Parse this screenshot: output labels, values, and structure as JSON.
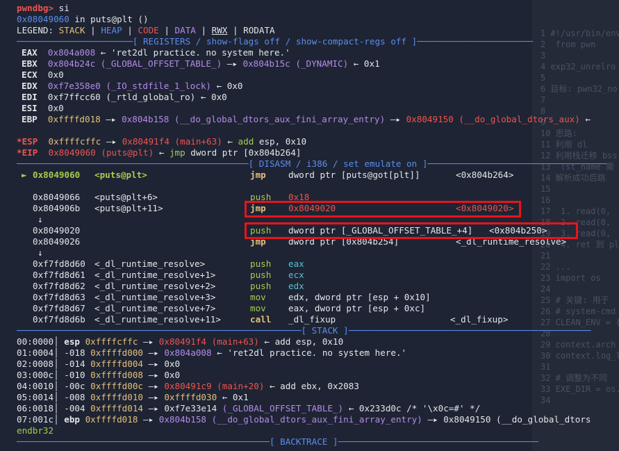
{
  "prompt": {
    "name": "pwndbg>",
    "cmd": " si"
  },
  "addr_line": {
    "addr": "0x08049060",
    "rest": " in puts@plt ()"
  },
  "legend": {
    "prefix": "LEGEND: ",
    "stack": "STACK",
    "heap": "HEAP",
    "code": "CODE",
    "data": "DATA",
    "rwx": "RWX",
    "rodata": "RODATA",
    "sep": " | "
  },
  "headers": {
    "registers": "[ REGISTERS / show-flags off / show-compact-regs off ]",
    "disasm": "[ DISASM / i386 / set emulate on ]",
    "stack": "[ STACK ]",
    "backtrace": "[ BACKTRACE ]"
  },
  "registers": {
    "eax": {
      "name": "EAX",
      "val": "0x804a008",
      "arrow": " ← ",
      "str": "'ret2dl practice. no system here.'"
    },
    "ebx": {
      "name": "EBX",
      "val": "0x804b24c",
      "sym": "(_GLOBAL_OFFSET_TABLE_)",
      "arrow": " —▸ ",
      "val2": "0x804b15c",
      "sym2": "(_DYNAMIC)",
      "arrow2": " ← ",
      "val3": "0x1"
    },
    "ecx": {
      "name": "ECX",
      "val": "0x0"
    },
    "edx": {
      "name": "EDX",
      "val": "0xf7e358e0",
      "sym": "(_IO_stdfile_1_lock)",
      "arrow": " ← ",
      "val2": "0x0"
    },
    "edi": {
      "name": "EDI",
      "val": "0xf7ffcc60",
      "sym": "(_rtld_global_ro)",
      "arrow": " ← ",
      "val2": "0x0"
    },
    "esi": {
      "name": "ESI",
      "val": "0x0"
    },
    "ebp": {
      "name": "EBP",
      "val": "0xffffd018",
      "arrow": " —▸ ",
      "val2": "0x804b158",
      "sym2": "(__do_global_dtors_aux_fini_array_entry)",
      "arrow2": " —▸ ",
      "val3": "0x8049150",
      "sym3": "(__do_global_dtors_aux)",
      "arrow3": " ←"
    },
    "esp": {
      "name": "*ESP",
      "val": "0xffffcffc",
      "arrow": " —▸ ",
      "val2": "0x80491f4",
      "sym2": "(main+63)",
      "arrow2": " ← ",
      "ins": "add",
      "ops": " esp, 0x10"
    },
    "eip": {
      "name": "*EIP",
      "val": "0x8049060",
      "sym": "(puts@plt)",
      "arrow": " ← ",
      "ins": "jmp",
      "ops": " dword ptr [0x804b264]"
    }
  },
  "disasm": [
    {
      "marker": "► ",
      "addr": "0x8049060",
      "sym": "<puts@plt>",
      "mn": "jmp",
      "ops": "dword ptr [puts@got[plt]]",
      "cmt": "<0x804b264>"
    },
    {
      "marker": "",
      "addr": "0x8049066",
      "sym": "<puts@plt+6>",
      "mn": "push",
      "ops": "0x18",
      "cmt": ""
    },
    {
      "marker": "",
      "addr": "0x804906b",
      "sym": "<puts@plt+11>",
      "mn": "jmp",
      "ops": "0x8049020",
      "cmt": "<0x8049020>"
    },
    {
      "marker": "↓",
      "addr": "",
      "sym": "",
      "mn": "",
      "ops": "",
      "cmt": ""
    },
    {
      "marker": "",
      "addr": "0x8049020",
      "sym": "",
      "mn": "push",
      "ops": "dword ptr [_GLOBAL_OFFSET_TABLE_+4]",
      "cmt": "<0x804b250>"
    },
    {
      "marker": "",
      "addr": "0x8049026",
      "sym": "",
      "mn": "jmp",
      "ops": "dword ptr [0x804b254]",
      "cmt": "<_dl_runtime_resolve>"
    },
    {
      "marker": "↓",
      "addr": "",
      "sym": "",
      "mn": "",
      "ops": "",
      "cmt": ""
    },
    {
      "marker": "",
      "addr": "0xf7fd8d60",
      "sym": "<_dl_runtime_resolve>",
      "mn": "push",
      "ops": "eax",
      "cmt": ""
    },
    {
      "marker": "",
      "addr": "0xf7fd8d61",
      "sym": "<_dl_runtime_resolve+1>",
      "mn": "push",
      "ops": "ecx",
      "cmt": ""
    },
    {
      "marker": "",
      "addr": "0xf7fd8d62",
      "sym": "<_dl_runtime_resolve+2>",
      "mn": "push",
      "ops": "edx",
      "cmt": ""
    },
    {
      "marker": "",
      "addr": "0xf7fd8d63",
      "sym": "<_dl_runtime_resolve+3>",
      "mn": "mov",
      "ops": "edx, dword ptr [esp + 0x10]",
      "cmt": ""
    },
    {
      "marker": "",
      "addr": "0xf7fd8d67",
      "sym": "<_dl_runtime_resolve+7>",
      "mn": "mov",
      "ops": "eax, dword ptr [esp + 0xc]",
      "cmt": ""
    },
    {
      "marker": "",
      "addr": "0xf7fd8d6b",
      "sym": "<_dl_runtime_resolve+11>",
      "mn": "call",
      "ops": "_dl_fixup",
      "cmt": "<_dl_fixup>"
    }
  ],
  "stack": [
    {
      "idx": "00:0000",
      "reg": "esp",
      "off": "",
      "addr": "0xffffcffc",
      "rest1": "0x80491f4",
      "rest2": "(main+63)",
      "rest3": " ← add esp, 0x10"
    },
    {
      "idx": "01:0004",
      "reg": "",
      "off": "-018",
      "addr": "0xffffd000",
      "rest1": "0x804a008",
      "rest2": "",
      "rest3": " ← 'ret2dl practice. no system here.'"
    },
    {
      "idx": "02:0008",
      "reg": "",
      "off": "-014",
      "addr": "0xffffd004",
      "rest1": "",
      "rest2": "",
      "rest3": " ← 0x0"
    },
    {
      "idx": "03:000c",
      "reg": "",
      "off": "-010",
      "addr": "0xffffd008",
      "rest1": "",
      "rest2": "",
      "rest3": " ← 0x0"
    },
    {
      "idx": "04:0010",
      "reg": "",
      "off": "-00c",
      "addr": "0xffffd00c",
      "rest1": "0x80491c9",
      "rest2": "(main+20)",
      "rest3": " ← add ebx, 0x2083"
    },
    {
      "idx": "05:0014",
      "reg": "",
      "off": "-008",
      "addr": "0xffffd010",
      "rest1": "0xffffd030",
      "rest2": "",
      "rest3": " ← 0x1"
    },
    {
      "idx": "06:0018",
      "reg": "",
      "off": "-004",
      "addr": "0xffffd014",
      "rest1": "0xf7e33e14",
      "rest2": "(_GLOBAL_OFFSET_TABLE_)",
      "rest3": " ← 0x233d0c /* '\\x0c=#' */"
    },
    {
      "idx": "07:001c",
      "reg": "ebp",
      "off": "",
      "addr": "0xffffd018",
      "rest1": "0x804b158",
      "rest2": "(__do_global_dtors_aux_fini_array_entry)",
      "rest3": " —▸ 0x8049150 (__do_global_dtors"
    }
  ],
  "endbr": "endbr32",
  "bg_code": [
    "1 #!/usr/bin/env",
    "2  from pwn",
    "3",
    "4 exp32_unrelro",
    "5",
    "6 目标: pwn32_no",
    "7",
    "8",
    "9",
    "10 思路:",
    "11 利用 dl",
    "12 利用栈迁移 bss",
    "13  (st_name 需",
    "14 解析成功后跳",
    "15",
    "16",
    "17  1. read(0,",
    "18  2. read(0,",
    "19  3. read(0,",
    "20  4. ret 到 pl",
    "21",
    "22 ...",
    "23 import os",
    "24",
    "25 # 关键: 用于",
    "26 # system-cmd",
    "27 CLEAN_ENV = {",
    "28",
    "29 context.arch =",
    "30 context.log_le",
    "31",
    "32 # 调整为不同",
    "33 EXE_DIR = os.",
    "34"
  ]
}
